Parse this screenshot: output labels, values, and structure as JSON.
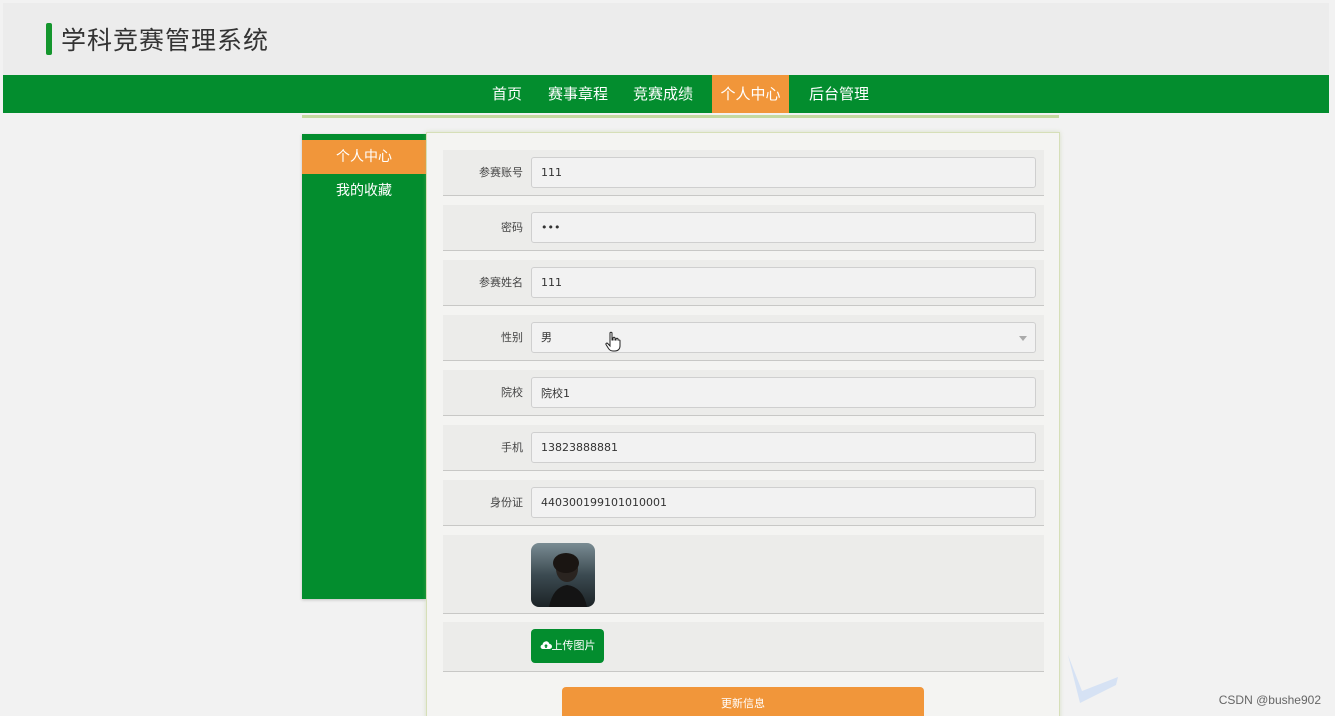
{
  "app": {
    "title": "学科竞赛管理系统"
  },
  "nav": {
    "items": [
      {
        "label": "首页"
      },
      {
        "label": "赛事章程"
      },
      {
        "label": "竞赛成绩"
      },
      {
        "label": "个人中心"
      },
      {
        "label": "后台管理"
      }
    ],
    "active_index": 3
  },
  "sidebar": {
    "items": [
      {
        "label": "个人中心"
      },
      {
        "label": "我的收藏"
      }
    ],
    "active_index": 0
  },
  "form": {
    "fields": [
      {
        "label": "参赛账号",
        "value": "111"
      },
      {
        "label": "密码",
        "value": "•••"
      },
      {
        "label": "参赛姓名",
        "value": "111"
      },
      {
        "label": "性别",
        "value": "男"
      },
      {
        "label": "院校",
        "value": "院校1"
      },
      {
        "label": "手机",
        "value": "13823888881"
      },
      {
        "label": "身份证",
        "value": "440300199101010001"
      }
    ],
    "upload_label": "上传图片",
    "upload_icon": "cloud-upload-icon",
    "submit_label": "更新信息"
  },
  "watermark": "CSDN @bushe902",
  "colors": {
    "primary_green": "#038d2e",
    "accent_orange": "#f1963a",
    "header_bg": "#ececec",
    "page_bg": "#f2f2f2"
  }
}
